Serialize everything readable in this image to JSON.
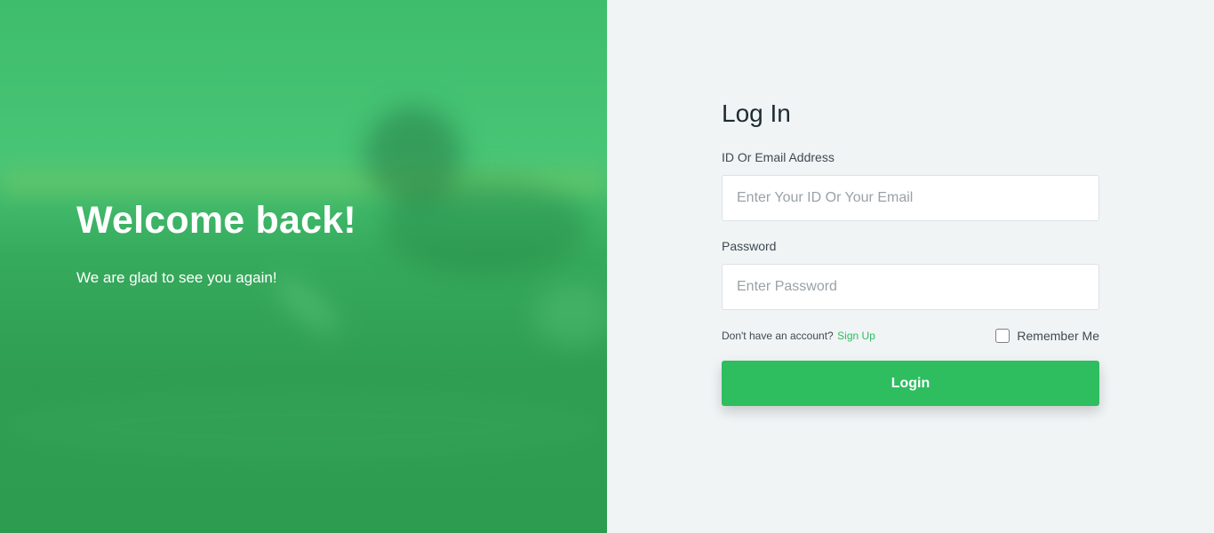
{
  "hero": {
    "title": "Welcome back!",
    "subtitle": "We are glad to see you again!"
  },
  "login": {
    "title": "Log In",
    "id_label": "ID Or Email Address",
    "id_placeholder": "Enter Your ID Or Your Email",
    "id_value": "",
    "password_label": "Password",
    "password_placeholder": "Enter Password",
    "password_value": "",
    "signup_prompt": "Don't have an account?",
    "signup_link": "Sign Up",
    "remember_label": "Remember Me",
    "remember_checked": false,
    "submit_label": "Login"
  },
  "colors": {
    "accent": "#2ebd5f",
    "panel_bg": "#f0f4f5",
    "hero_green": "#36aa5c"
  }
}
